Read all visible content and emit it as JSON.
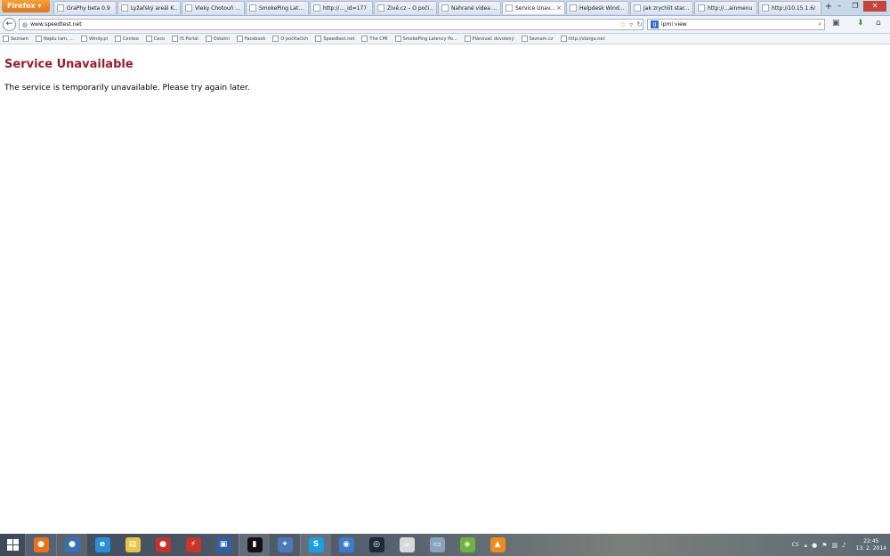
{
  "browser": {
    "menu_label": "Firefox",
    "tabs": [
      {
        "label": "GraPhy beta 0.9",
        "active": false
      },
      {
        "label": "Lyžařský areál K...",
        "active": false
      },
      {
        "label": "Vleky Chotouň ...",
        "active": false
      },
      {
        "label": "SmokePing Lat...",
        "active": false
      },
      {
        "label": "http://..._id=177",
        "active": false
      },
      {
        "label": "Živě.cz – O poči...",
        "active": false
      },
      {
        "label": "Nahrané videa ...",
        "active": false
      },
      {
        "label": "Service Unav...",
        "active": true
      },
      {
        "label": "Helpdesk Wind...",
        "active": false
      },
      {
        "label": "Jak zrychlit star...",
        "active": false
      },
      {
        "label": "http://...ainmenu",
        "active": false
      },
      {
        "label": "http://10.15.1.6/",
        "active": false
      }
    ],
    "new_tab_label": "+",
    "url": "www.speedtest.net",
    "search_value": "ipmi view"
  },
  "bookmarks": [
    "Seznam",
    "Najdu tam, ...",
    "Windy.pl",
    "Centeo",
    "Ceco",
    "IS Portál",
    "Ostatní",
    "Facebook",
    "O počítačích",
    "Speedtest.net",
    "The CMI",
    "SmokePing Latency Po...",
    "Plánovač dovolený",
    "Seznam.cz",
    "http://starga.net"
  ],
  "page": {
    "error_title": "Service Unavailable",
    "error_message": "The service is temporarily unavailable. Please try again later."
  },
  "taskbar": {
    "apps": [
      {
        "name": "firefox",
        "glyph": "●",
        "color": "#e8711c",
        "running": true
      },
      {
        "name": "thunderbird",
        "glyph": "●",
        "color": "#3a6fb0",
        "running": true
      },
      {
        "name": "internet-explorer",
        "glyph": "e",
        "color": "#2a8fd8",
        "running": false
      },
      {
        "name": "file-explorer",
        "glyph": "▤",
        "color": "#e8c34a",
        "running": false
      },
      {
        "name": "media",
        "glyph": "●",
        "color": "#c8322d",
        "running": false
      },
      {
        "name": "filezilla",
        "glyph": "⚡",
        "color": "#c9352a",
        "running": false
      },
      {
        "name": "disk-tool",
        "glyph": "▣",
        "color": "#2f5fa8",
        "running": false
      },
      {
        "name": "terminal",
        "glyph": "▮",
        "color": "#111111",
        "running": true
      },
      {
        "name": "network-tool",
        "glyph": "✦",
        "color": "#4d78b8",
        "running": false
      },
      {
        "name": "skype",
        "glyph": "S",
        "color": "#1aa0e0",
        "running": true
      },
      {
        "name": "vm-client",
        "glyph": "◉",
        "color": "#3b7bc8",
        "running": false
      },
      {
        "name": "steam",
        "glyph": "◎",
        "color": "#1e2a38",
        "running": false
      },
      {
        "name": "java",
        "glyph": "☕",
        "color": "#d9d9d9",
        "running": false
      },
      {
        "name": "remote-desktop",
        "glyph": "▭",
        "color": "#8aa3bf",
        "running": false
      },
      {
        "name": "vmware",
        "glyph": "◈",
        "color": "#6fb33c",
        "running": false
      },
      {
        "name": "vlc",
        "glyph": "▲",
        "color": "#f08a1c",
        "running": false
      }
    ],
    "tray_lang": "CS",
    "clock_time": "22:45",
    "clock_date": "13. 2. 2014"
  }
}
